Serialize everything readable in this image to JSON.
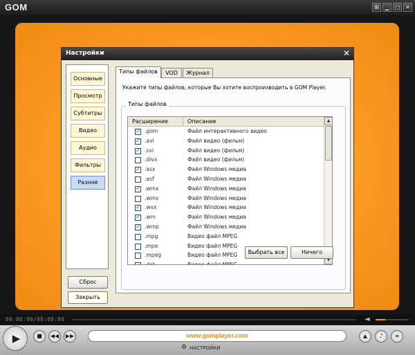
{
  "player": {
    "logo": "GOM",
    "window_buttons": [
      "⊞",
      "▁",
      "□",
      "✕"
    ],
    "time": "00:00:00/00:00:00",
    "volume_fraction": 0.3,
    "site": "www.gomplayer.com",
    "settings_label": "НАСТРОЙКИ",
    "accent_color": "#f39420"
  },
  "dialog": {
    "title": "Настройки",
    "nav": [
      "Основные",
      "Просмотр",
      "Субтитры",
      "Видео",
      "Аудио",
      "Фильтры",
      "Разное"
    ],
    "active_nav": "Разное",
    "reset_label": "Сброс",
    "close_label": "Закрыть",
    "tabs": [
      "Типы файлов",
      "VOD",
      "Журнал"
    ],
    "active_tab": "Типы файлов",
    "instruction": "Укажите типы файлов, которые Вы хотите воспроизводить в GOM Player.",
    "group_label": "Типы файлов",
    "columns": [
      "Расширение",
      "Описание"
    ],
    "rows": [
      {
        "ext": ".gom",
        "desc": "Файл интерактивного видео",
        "checked": true
      },
      {
        "ext": ".avi",
        "desc": "Файл видео (фильм)",
        "checked": true
      },
      {
        "ext": ".svi",
        "desc": "Файл видео (фильм)",
        "checked": true
      },
      {
        "ext": ".divx",
        "desc": "Файл видео (фильм)",
        "checked": false
      },
      {
        "ext": ".asx",
        "desc": "Файл Windows медиа",
        "checked": true
      },
      {
        "ext": ".asf",
        "desc": "Файл Windows медиа",
        "checked": false
      },
      {
        "ext": ".wmx",
        "desc": "Файл Windows медиа",
        "checked": true
      },
      {
        "ext": ".wmv",
        "desc": "Файл Windows медиа",
        "checked": false
      },
      {
        "ext": ".wvx",
        "desc": "Файл Windows медиа",
        "checked": true
      },
      {
        "ext": ".wm",
        "desc": "Файл Windows медиа",
        "checked": true
      },
      {
        "ext": ".wmp",
        "desc": "Файл Windows медиа",
        "checked": true
      },
      {
        "ext": ".mpg",
        "desc": "Видео файл MPEG",
        "checked": false
      },
      {
        "ext": ".mpe",
        "desc": "Видео файл MPEG",
        "checked": false
      },
      {
        "ext": ".mpeg",
        "desc": "Видео файл MPEG",
        "checked": false
      },
      {
        "ext": ".dat",
        "desc": "Видео файл MPEG",
        "checked": false
      }
    ],
    "select_all_label": "Выбрать все",
    "none_label": "Ничего"
  }
}
